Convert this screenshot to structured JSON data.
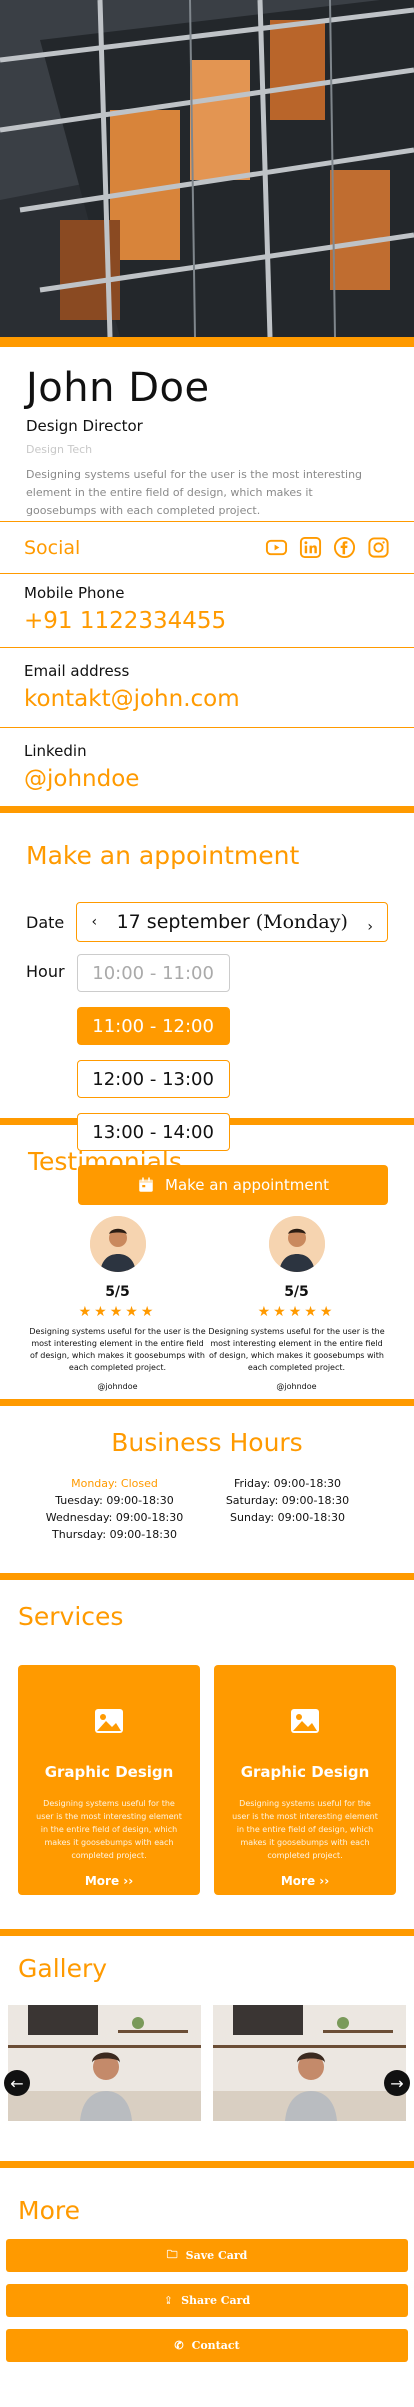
{
  "profile": {
    "name": "John Doe",
    "role": "Design Director",
    "company": "Design Tech",
    "description": "Designing systems useful for the user is the most interesting element in the entire field of design, which makes it goosebumps with each completed project."
  },
  "social": {
    "title": "Social",
    "icons": [
      "youtube-icon",
      "linkedin-icon",
      "facebook-icon",
      "instagram-icon"
    ]
  },
  "contacts": [
    {
      "label": "Mobile Phone",
      "value": "+91 1122334455"
    },
    {
      "label": "Email address",
      "value": "kontakt@john.com"
    },
    {
      "label": "Linkedin",
      "value": "@johndoe"
    }
  ],
  "appointment": {
    "title_prefix": "Make an",
    "title_main": "appointment",
    "date_label": "Date",
    "date_value": "17 september",
    "date_day": "(Monday)",
    "hour_label": "Hour",
    "hours": [
      "10:00 - 11:00",
      "11:00 - 12:00",
      "12:00 - 13:00",
      "13:00 - 14:00"
    ],
    "button": "Make an appointment"
  },
  "testimonials": {
    "title": "Testimonials",
    "items": [
      {
        "rating": "5/5",
        "stars": "★★★★★",
        "text": "Designing systems useful for the user is the most interesting element in the entire field of design, which makes it goosebumps with each completed project.",
        "user": "@johndoe"
      },
      {
        "rating": "5/5",
        "stars": "★★★★★",
        "text": "Designing systems useful for the user is the most interesting element in the entire field of design, which makes it goosebumps with each completed project.",
        "user": "@johndoe"
      }
    ]
  },
  "business_hours": {
    "title": "Business Hours",
    "left": [
      "Monday: Closed",
      "Tuesday: 09:00-18:30",
      "Wednesday: 09:00-18:30",
      "Thursday: 09:00-18:30"
    ],
    "right": [
      "Friday: 09:00-18:30",
      "Saturday: 09:00-18:30",
      "Sunday: 09:00-18:30"
    ]
  },
  "services": {
    "title": "Services",
    "items": [
      {
        "title": "Graphic Design",
        "desc": "Designing systems useful for the user is the most interesting element in the entire field of design, which makes it goosebumps with each completed project.",
        "more": "More ››"
      },
      {
        "title": "Graphic Design",
        "desc": "Designing systems useful for the user is the most interesting element in the entire field of design, which makes it goosebumps with each completed project.",
        "more": "More ››"
      }
    ]
  },
  "gallery": {
    "title": "Gallery"
  },
  "more": {
    "title": "More",
    "buttons": [
      "Save Card",
      "Share Card",
      "Contact"
    ]
  },
  "colors": {
    "accent": "#ff9a00"
  }
}
